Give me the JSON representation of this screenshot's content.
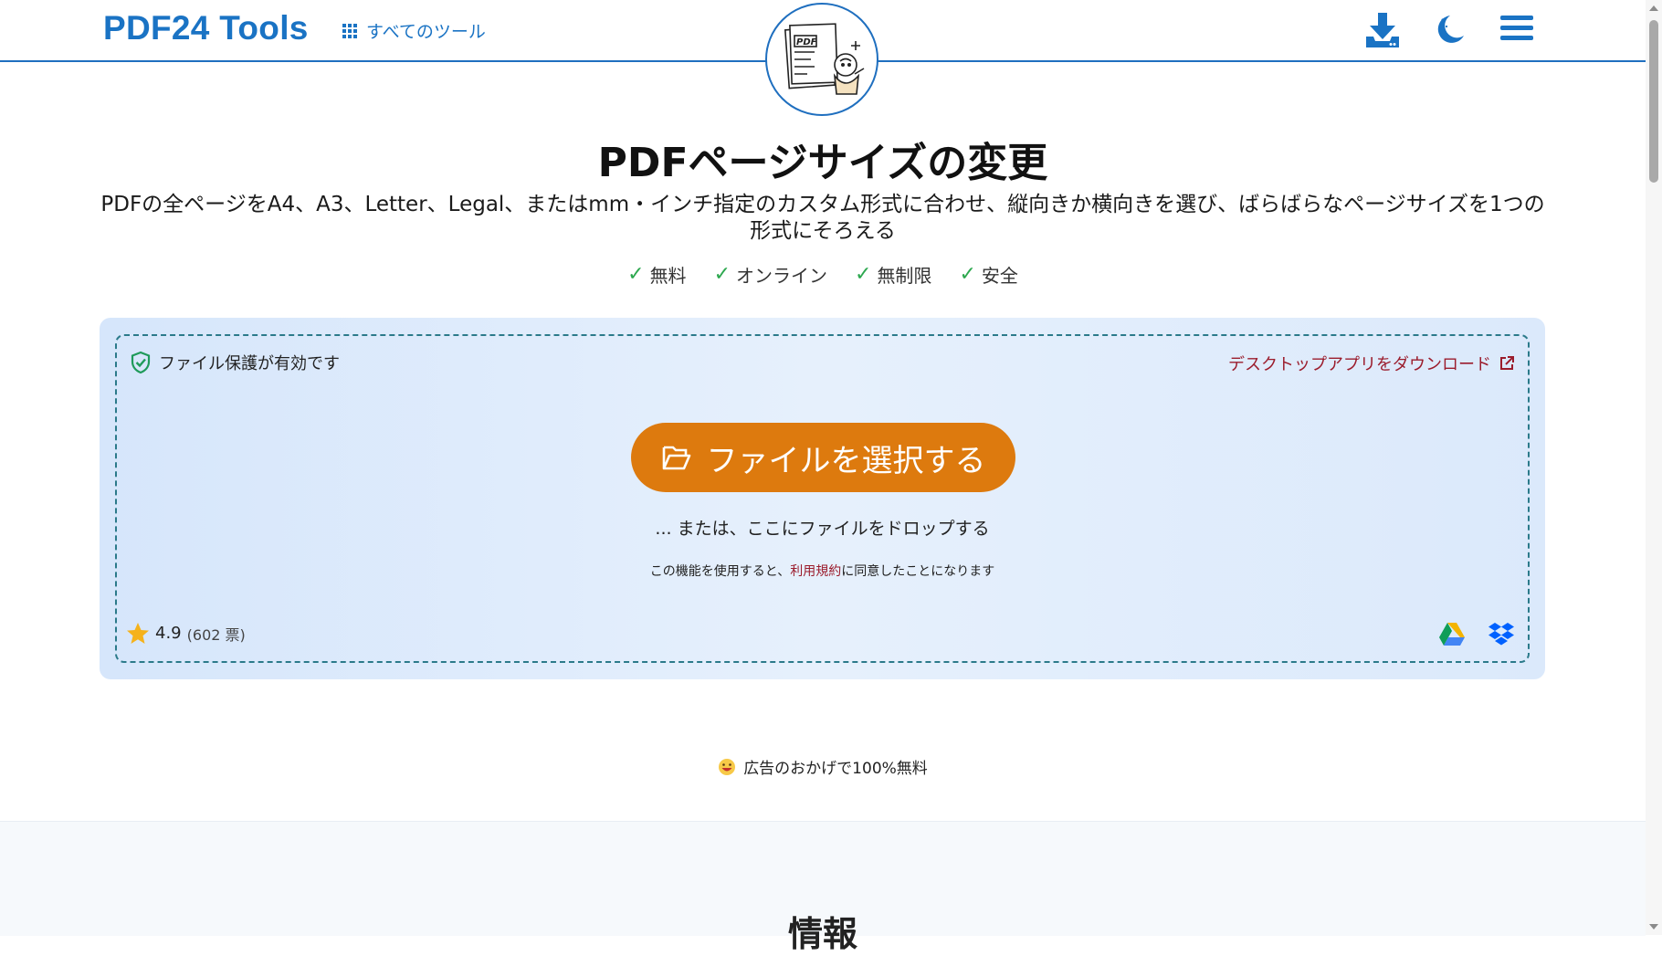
{
  "header": {
    "logo": "PDF24 Tools",
    "all_tools_label": "すべてのツール",
    "icons": [
      "download-icon",
      "moon-icon",
      "menu-icon"
    ]
  },
  "mascot": {
    "sign_text": "PDF"
  },
  "main": {
    "title": "PDFページサイズの変更",
    "subtitle": "PDFの全ページをA4、A3、Letter、Legal、またはmm・インチ指定のカスタム形式に合わせ、縦向きか横向きを選び、ばらばらなページサイズを1つの形式にそろえる",
    "features": [
      "無料",
      "オンライン",
      "無制限",
      "安全"
    ]
  },
  "upload": {
    "protection_label": "ファイル保護が有効です",
    "desktop_link": "デスクトップアプリをダウンロード",
    "choose_button": "ファイルを選択する",
    "drop_text": "... または、ここにファイルをドロップする",
    "terms_prefix": "この機能を使用すると、",
    "terms_link": "利用規約",
    "terms_suffix": "に同意したことになります",
    "rating_value": "4.9",
    "rating_votes": "(602 票)",
    "cloud_icons": [
      "google-drive-icon",
      "dropbox-icon"
    ]
  },
  "ad_note": "広告のおかげで100%無料",
  "info": {
    "title": "情報"
  },
  "colors": {
    "brand_blue": "#1a73c4",
    "accent_orange": "#dd7a0e",
    "link_red": "#9b1c2c",
    "check_green": "#2da84f"
  }
}
